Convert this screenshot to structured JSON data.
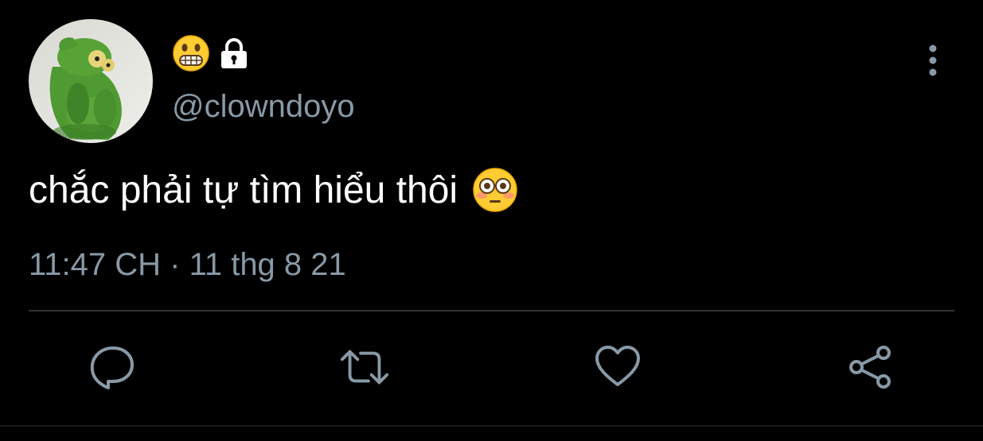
{
  "tweet": {
    "display_name_emoji": "grimacing-face-emoji",
    "protected_icon": "lock-icon",
    "handle": "@clowndoyo",
    "text": "chắc phải tự tìm hiểu thôi",
    "text_emoji": "flushed-face-emoji",
    "timestamp": "11:47 CH · 11 thg 8 21"
  },
  "menu": {
    "icon": "more-vertical-icon"
  },
  "actions": [
    {
      "name": "reply",
      "icon": "speech-bubble-icon"
    },
    {
      "name": "retweet",
      "icon": "retweet-icon"
    },
    {
      "name": "like",
      "icon": "heart-icon"
    },
    {
      "name": "share",
      "icon": "share-icon"
    }
  ],
  "colors": {
    "background": "#000000",
    "primary_text": "#ffffff",
    "secondary_text": "#8899a6",
    "divider": "#2f3336",
    "avatar_frog": "#4f9a32"
  }
}
